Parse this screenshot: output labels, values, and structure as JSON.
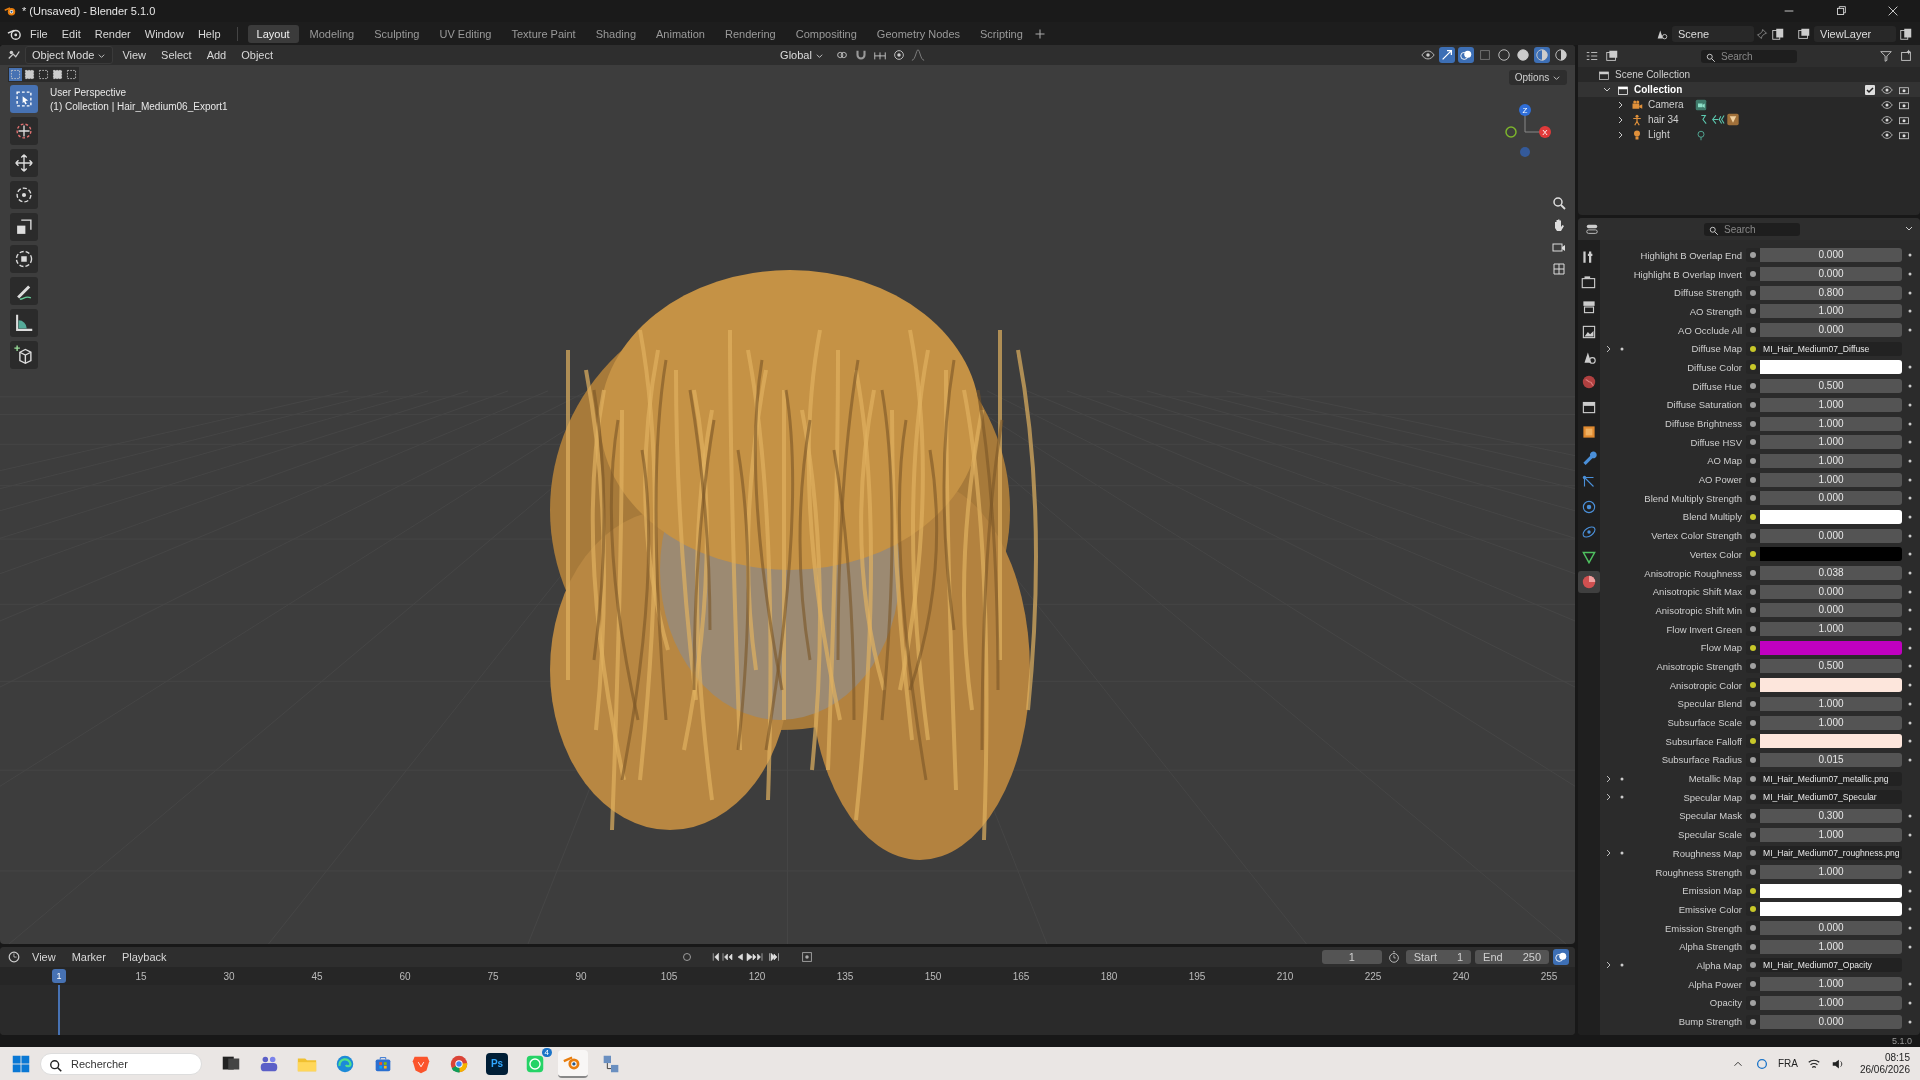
{
  "window": {
    "title": "* (Unsaved) - Blender 5.1.0"
  },
  "menu": [
    "File",
    "Edit",
    "Render",
    "Window",
    "Help"
  ],
  "workspaces": [
    {
      "label": "Layout",
      "selected": true
    },
    {
      "label": "Modeling",
      "selected": false
    },
    {
      "label": "Sculpting",
      "selected": false
    },
    {
      "label": "UV Editing",
      "selected": false
    },
    {
      "label": "Texture Paint",
      "selected": false
    },
    {
      "label": "Shading",
      "selected": false
    },
    {
      "label": "Animation",
      "selected": false
    },
    {
      "label": "Rendering",
      "selected": false
    },
    {
      "label": "Compositing",
      "selected": false
    },
    {
      "label": "Geometry Nodes",
      "selected": false
    },
    {
      "label": "Scripting",
      "selected": false
    }
  ],
  "scene": {
    "name": "Scene",
    "view_layer": "ViewLayer"
  },
  "viewport": {
    "mode": "Object Mode",
    "menus": [
      "View",
      "Select",
      "Add",
      "Object"
    ],
    "orientation": "Global",
    "options": "Options",
    "shading_modes": [
      {
        "selected": false
      },
      {
        "selected": false
      },
      {
        "selected": true
      },
      {
        "selected": false
      }
    ],
    "select_modes": [
      {
        "selected": true
      },
      {
        "selected": false
      },
      {
        "selected": false
      },
      {
        "selected": false
      },
      {
        "selected": false
      }
    ],
    "tools": [
      {
        "kind": "select",
        "selected": true
      },
      {
        "kind": "cursor",
        "selected": false
      },
      {
        "kind": "move",
        "selected": false
      },
      {
        "kind": "rotate",
        "selected": false
      },
      {
        "kind": "scale",
        "selected": false
      },
      {
        "kind": "transform",
        "selected": false
      },
      {
        "kind": "annotate",
        "selected": false
      },
      {
        "kind": "measure",
        "selected": false
      },
      {
        "kind": "add-cube",
        "selected": false
      }
    ],
    "overlay": [
      "User Perspective",
      "(1) Collection | Hair_Medium06_Export1"
    ],
    "gizmo": {
      "z": "Z",
      "x": "X"
    }
  },
  "outliner": {
    "search": {
      "placeholder": "Search"
    },
    "root": "Scene Collection",
    "collection": {
      "name": "Collection",
      "expanded": true,
      "checked": true,
      "children": [
        {
          "name": "Camera",
          "kind": "camera",
          "expanded": false
        },
        {
          "name": "hair 34",
          "kind": "armature",
          "expanded": false
        },
        {
          "name": "Light",
          "kind": "light",
          "expanded": false
        }
      ]
    }
  },
  "properties": {
    "search": {
      "placeholder": "Search"
    },
    "tabs": [
      {
        "kind": "tool",
        "selected": false
      },
      {
        "kind": "render",
        "selected": false
      },
      {
        "kind": "output",
        "selected": false
      },
      {
        "kind": "view",
        "selected": false
      },
      {
        "kind": "scene",
        "selected": false
      },
      {
        "kind": "world",
        "selected": false
      },
      {
        "kind": "collection",
        "selected": false
      },
      {
        "kind": "object",
        "selected": false
      },
      {
        "kind": "modifier",
        "selected": false
      },
      {
        "kind": "particles",
        "selected": false
      },
      {
        "kind": "physics",
        "selected": false
      },
      {
        "kind": "constraint",
        "selected": false
      },
      {
        "kind": "data",
        "selected": false
      },
      {
        "kind": "material",
        "selected": true
      }
    ],
    "rows": [
      {
        "label": "Highlight B Overlap End",
        "kind": "value",
        "value": "0.000",
        "color_socket": false
      },
      {
        "label": "Highlight B Overlap Invert",
        "kind": "value",
        "value": "0.000",
        "color_socket": false
      },
      {
        "label": "Diffuse Strength",
        "kind": "value",
        "value": "0.800",
        "color_socket": false
      },
      {
        "label": "AO Strength",
        "kind": "value",
        "value": "1.000",
        "color_socket": false
      },
      {
        "label": "AO Occlude All",
        "kind": "value",
        "value": "0.000",
        "color_socket": false
      },
      {
        "label": "Diffuse Map",
        "kind": "map",
        "value": "MI_Hair_Medium07_Diffuse",
        "color_socket": true,
        "expanded": false
      },
      {
        "label": "Diffuse Color",
        "kind": "color",
        "color": "#ffffff",
        "color_socket": true
      },
      {
        "label": "Diffuse Hue",
        "kind": "value",
        "value": "0.500",
        "color_socket": false
      },
      {
        "label": "Diffuse Saturation",
        "kind": "value",
        "value": "1.000",
        "color_socket": false
      },
      {
        "label": "Diffuse Brightness",
        "kind": "value",
        "value": "1.000",
        "color_socket": false
      },
      {
        "label": "Diffuse HSV",
        "kind": "value",
        "value": "1.000",
        "color_socket": false
      },
      {
        "label": "AO Map",
        "kind": "value",
        "value": "1.000",
        "color_socket": false
      },
      {
        "label": "AO Power",
        "kind": "value",
        "value": "1.000",
        "color_socket": false
      },
      {
        "label": "Blend Multiply Strength",
        "kind": "value",
        "value": "0.000",
        "color_socket": false
      },
      {
        "label": "Blend Multiply",
        "kind": "color",
        "color": "#ffffff",
        "color_socket": true
      },
      {
        "label": "Vertex Color Strength",
        "kind": "value",
        "value": "0.000",
        "color_socket": false
      },
      {
        "label": "Vertex Color",
        "kind": "color",
        "color": "#000000",
        "color_socket": true
      },
      {
        "label": "Anisotropic Roughness",
        "kind": "value",
        "value": "0.038",
        "color_socket": false
      },
      {
        "label": "Anisotropic Shift Max",
        "kind": "value",
        "value": "0.000",
        "color_socket": false
      },
      {
        "label": "Anisotropic Shift Min",
        "kind": "value",
        "value": "0.000",
        "color_socket": false
      },
      {
        "label": "Flow Invert Green",
        "kind": "value",
        "value": "1.000",
        "color_socket": false
      },
      {
        "label": "Flow Map",
        "kind": "color",
        "color": "#c000c0",
        "color_socket": true
      },
      {
        "label": "Anisotropic Strength",
        "kind": "value",
        "value": "0.500",
        "color_socket": false
      },
      {
        "label": "Anisotropic Color",
        "kind": "color",
        "color": "#fde6dc",
        "color_socket": true
      },
      {
        "label": "Specular Blend",
        "kind": "value",
        "value": "1.000",
        "color_socket": false
      },
      {
        "label": "Subsurface Scale",
        "kind": "value",
        "value": "1.000",
        "color_socket": false
      },
      {
        "label": "Subsurface Falloff",
        "kind": "color",
        "color": "#fde6dc",
        "color_socket": true
      },
      {
        "label": "Subsurface Radius",
        "kind": "value",
        "value": "0.015",
        "color_socket": false
      },
      {
        "label": "Metallic Map",
        "kind": "map",
        "value": "MI_Hair_Medium07_metallic.png",
        "color_socket": false,
        "expanded": false
      },
      {
        "label": "Specular Map",
        "kind": "map",
        "value": "MI_Hair_Medium07_Specular",
        "color_socket": false,
        "expanded": false
      },
      {
        "label": "Specular Mask",
        "kind": "value",
        "value": "0.300",
        "color_socket": false
      },
      {
        "label": "Specular Scale",
        "kind": "value",
        "value": "1.000",
        "color_socket": false
      },
      {
        "label": "Roughness Map",
        "kind": "map",
        "value": "MI_Hair_Medium07_roughness.png",
        "color_socket": false,
        "expanded": false
      },
      {
        "label": "Roughness Strength",
        "kind": "value",
        "value": "1.000",
        "color_socket": false
      },
      {
        "label": "Emission Map",
        "kind": "color",
        "color": "#ffffff",
        "color_socket": true
      },
      {
        "label": "Emissive Color",
        "kind": "color",
        "color": "#ffffff",
        "color_socket": true
      },
      {
        "label": "Emission Strength",
        "kind": "value",
        "value": "0.000",
        "color_socket": false
      },
      {
        "label": "Alpha Strength",
        "kind": "value",
        "value": "1.000",
        "color_socket": false
      },
      {
        "label": "Alpha Map",
        "kind": "map",
        "value": "MI_Hair_Medium07_Opacity",
        "color_socket": false,
        "expanded": false
      },
      {
        "label": "Alpha Power",
        "kind": "value",
        "value": "1.000",
        "color_socket": false
      },
      {
        "label": "Opacity",
        "kind": "value",
        "value": "1.000",
        "color_socket": false
      },
      {
        "label": "Bump Strength",
        "kind": "value",
        "value": "0.000",
        "color_socket": false
      }
    ]
  },
  "timeline": {
    "menus": [
      "View",
      "Marker",
      "Playback"
    ],
    "current_frame": "1",
    "start_label": "Start",
    "start": "1",
    "end_label": "End",
    "end": "250",
    "playhead": "1",
    "ruler": [
      "15",
      "30",
      "45",
      "60",
      "75",
      "90",
      "105",
      "120",
      "135",
      "150",
      "165",
      "180",
      "195",
      "210",
      "225",
      "240",
      "255"
    ]
  },
  "status_bar": {
    "version": "5.1.0"
  },
  "taskbar": {
    "search": {
      "placeholder": "Rechercher"
    },
    "apps": [
      {
        "kind": "taskview",
        "selected": false
      },
      {
        "kind": "teams",
        "selected": false
      },
      {
        "kind": "files",
        "selected": false
      },
      {
        "kind": "edge",
        "selected": false
      },
      {
        "kind": "store",
        "selected": false
      },
      {
        "kind": "brave",
        "selected": false
      },
      {
        "kind": "chrome",
        "selected": false
      },
      {
        "kind": "photoshop",
        "label": "Ps",
        "selected": false
      },
      {
        "kind": "whatsapp",
        "badge": "4",
        "selected": false
      },
      {
        "kind": "blender",
        "selected": true
      },
      {
        "kind": "tool",
        "selected": false
      }
    ],
    "language": "FRA",
    "time": "08:15",
    "date": "26/06/2026"
  }
}
